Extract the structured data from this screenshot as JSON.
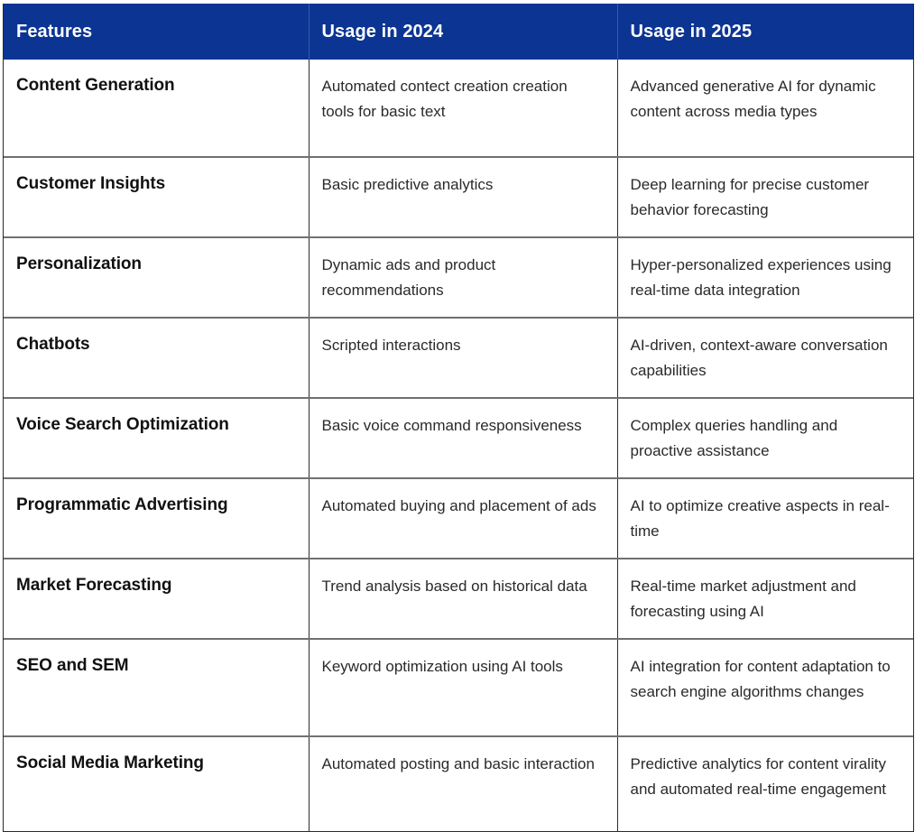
{
  "table": {
    "accent_color": "#0C3493",
    "header_text_color": "#FFFFFF",
    "row_divider_color": "#707070",
    "columns": [
      {
        "key": "feature",
        "label": "Features"
      },
      {
        "key": "usage_2024",
        "label": "Usage in 2024"
      },
      {
        "key": "usage_2025",
        "label": "Usage in 2025"
      }
    ],
    "rows": [
      {
        "feature": "Content Generation",
        "usage_2024": "Automated contect creation creation tools for basic text",
        "usage_2025": "Advanced generative AI for dynamic content across media types"
      },
      {
        "feature": "Customer Insights",
        "usage_2024": "Basic predictive analytics",
        "usage_2025": "Deep learning for precise customer behavior forecasting"
      },
      {
        "feature": "Personalization",
        "usage_2024": "Dynamic ads and product recommendations",
        "usage_2025": "Hyper-personalized experiences using real-time data integration"
      },
      {
        "feature": "Chatbots",
        "usage_2024": "Scripted interactions",
        "usage_2025": "AI-driven, context-aware conversation capabilities"
      },
      {
        "feature": "Voice Search Optimization",
        "usage_2024": "Basic voice command responsiveness",
        "usage_2025": "Complex queries handling and proactive assistance"
      },
      {
        "feature": "Programmatic Advertising",
        "usage_2024": "Automated buying and placement of ads",
        "usage_2025": "AI to optimize creative aspects in real-time"
      },
      {
        "feature": "Market Forecasting",
        "usage_2024": "Trend analysis based on historical data",
        "usage_2025": "Real-time market adjustment and forecasting using AI"
      },
      {
        "feature": "SEO and SEM",
        "usage_2024": "Keyword optimization using AI tools",
        "usage_2025": "AI integration for content adaptation to search engine algorithms changes"
      },
      {
        "feature": "Social Media Marketing",
        "usage_2024": "Automated posting and basic interaction",
        "usage_2025": "Predictive analytics for content virality and automated real-time engagement"
      }
    ]
  }
}
